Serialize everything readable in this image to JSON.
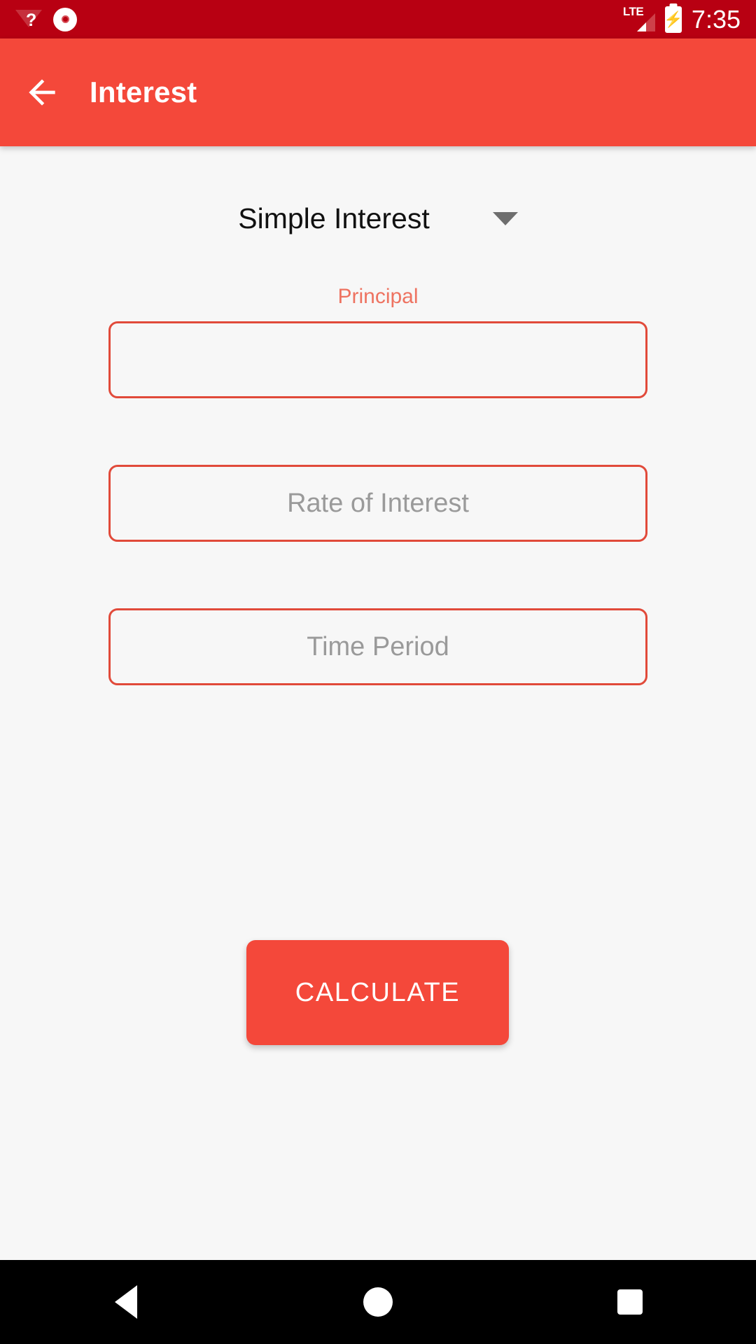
{
  "status_bar": {
    "background": "#B80012",
    "icons": [
      "wifi-question-icon",
      "record-icon",
      "lte-signal-icon",
      "battery-charging-icon"
    ],
    "network_label": "LTE",
    "battery_glyph": "⚡",
    "time": "7:35"
  },
  "app_bar": {
    "background": "#F4483A",
    "back_icon": "arrow-left-icon",
    "title": "Interest"
  },
  "content": {
    "background": "#F7F7F7",
    "type_selector": {
      "selected": "Simple Interest",
      "caret_icon": "chevron-down-icon",
      "caret_color": "#6E6E6E"
    },
    "fields": [
      {
        "name": "principal",
        "label": "Principal",
        "label_color": "#EE7361",
        "placeholder": "Principal",
        "value": "",
        "focused": true,
        "border_color": "#E14A3A"
      },
      {
        "name": "rate",
        "label": "",
        "label_color": "#EE7361",
        "placeholder": "Rate of Interest",
        "value": "",
        "focused": false,
        "border_color": "#E14A3A"
      },
      {
        "name": "time",
        "label": "",
        "label_color": "#EE7361",
        "placeholder": "Time Period",
        "value": "",
        "focused": false,
        "border_color": "#E14A3A"
      }
    ],
    "calculate_button": {
      "label": "CALCULATE",
      "background": "#F4483A",
      "text_color": "#FFFFFF"
    }
  },
  "nav_bar": {
    "background": "#000000",
    "buttons": [
      {
        "name": "back",
        "icon": "triangle-back-icon"
      },
      {
        "name": "home",
        "icon": "circle-home-icon"
      },
      {
        "name": "recents",
        "icon": "square-recents-icon"
      }
    ]
  }
}
